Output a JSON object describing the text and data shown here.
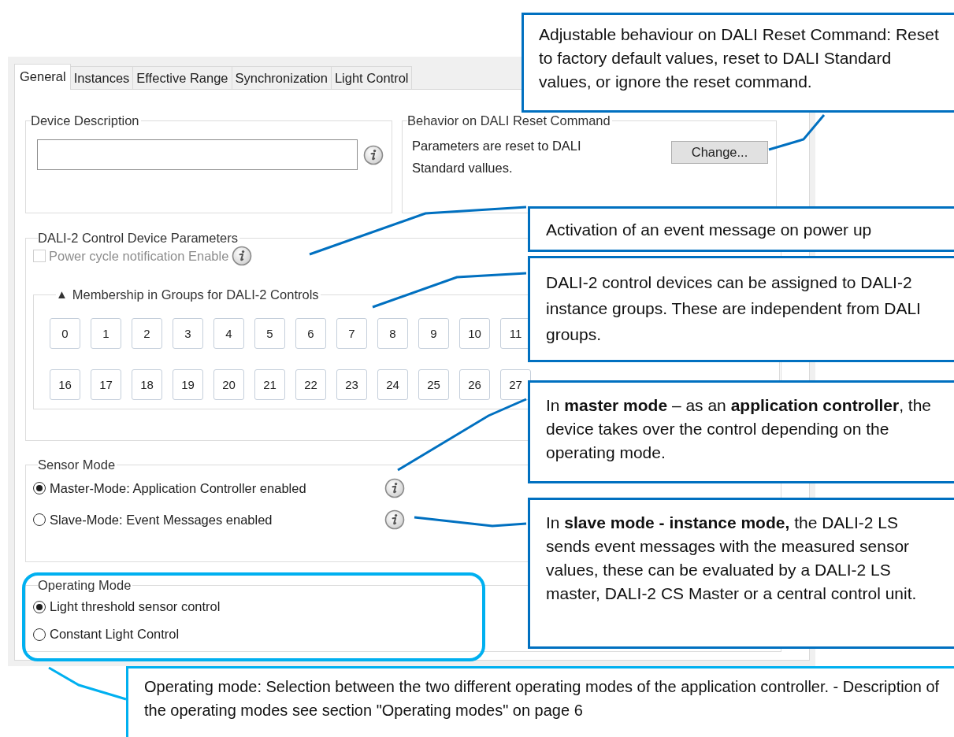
{
  "tabs": [
    {
      "label": "General",
      "selected": true
    },
    {
      "label": "Instances",
      "selected": false
    },
    {
      "label": "Effective Range",
      "selected": false
    },
    {
      "label": "Synchronization",
      "selected": false
    },
    {
      "label": "Light Control",
      "selected": false
    }
  ],
  "device_description": {
    "title": "Device Description"
  },
  "reset_behavior": {
    "title": "Behavior on DALI Reset Command",
    "text": "Parameters are reset to DALI Standard vallues.",
    "button": "Change..."
  },
  "control_device_parameters": {
    "title": "DALI-2 Control Device Parameters",
    "power_cycle": {
      "label": "Power cycle notification Enable",
      "checked": false,
      "disabled": true
    },
    "membership": {
      "toggle": "▲",
      "title": "Membership in Groups for DALI-2 Controls",
      "groups": [
        "0",
        "1",
        "2",
        "3",
        "4",
        "5",
        "6",
        "7",
        "8",
        "9",
        "10",
        "11",
        "16",
        "17",
        "18",
        "19",
        "20",
        "21",
        "22",
        "23",
        "24",
        "25",
        "26",
        "27"
      ]
    }
  },
  "sensor_mode": {
    "title": "Sensor Mode",
    "options": [
      {
        "label": "Master-Mode: Application Controller enabled",
        "selected": true
      },
      {
        "label": "Slave-Mode: Event Messages enabled",
        "selected": false
      }
    ]
  },
  "operating_mode": {
    "title": "Operating Mode",
    "options": [
      {
        "label": "Light threshold sensor control",
        "selected": true
      },
      {
        "label": "Constant Light Control",
        "selected": false
      }
    ]
  },
  "callouts": [
    {
      "text": "Adjustable behaviour on DALI Reset Command: Reset to factory default values, reset to DALI Standard values, or ignore the reset command.",
      "color": "#0070c0"
    },
    {
      "text": "Activation of an event message on power up",
      "color": "#0070c0"
    },
    {
      "text": "DALI-2 control devices can be assigned to DALI-2 instance groups. These are independent from DALI groups.",
      "color": "#0070c0"
    },
    {
      "text": "In **master mode** – as an **application controller**, the device takes over the control depending on the operating mode.",
      "color": "#0070c0"
    },
    {
      "text": "In **slave mode - instance mode,** the DALI-2 LS sends event messages with the measured sensor values, these can be evaluated by a DALI-2 LS master, DALI-2 CS Master or a central control unit.",
      "color": "#0070c0"
    },
    {
      "text": "Operating mode: Selection between the two different operating modes of the application controller. - Description of the operating modes see section \"Operating modes\" on page 6",
      "color": "#00b0f0"
    }
  ]
}
